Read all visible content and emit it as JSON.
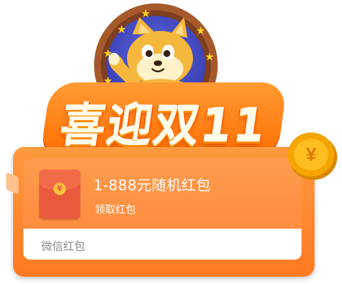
{
  "banner": {
    "title": "喜迎双11"
  },
  "coupon": {
    "amount_range": "1-888元随机红包",
    "action": "领取红包",
    "channel": "微信红包",
    "packet_symbol": "¥"
  },
  "coin": {
    "symbol": "¥"
  },
  "colors": {
    "card_orange": "#ff8a33",
    "title_orange": "#ff6d00",
    "packet_red": "#e95a3c",
    "coin_gold": "#f5a400",
    "badge_blue": "#3b3fb6",
    "badge_brown": "#7d3f1f"
  },
  "icons": [
    "shiba-mascot-icon",
    "star-icon",
    "red-packet-icon",
    "yuan-coin-icon"
  ]
}
